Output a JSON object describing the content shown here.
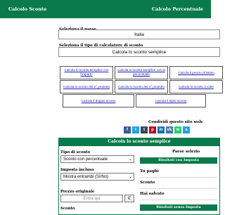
{
  "top_nav": {
    "tab1": "Calcolo Sconto",
    "tab2": "Calcolo Percentuale"
  },
  "country": {
    "label": "Seleziona il paese",
    "value": "Italia"
  },
  "calc_type": {
    "label": "Seleziona il tipo di calcolatore di sconto",
    "value": "Calcola lo sconto semplice"
  },
  "buttons": {
    "row1": [
      "Calcola lo sconto semplice con l'importo",
      "Calcola lo sconto semplice con la percentuale",
      "Calcola il prezzo di listino"
    ],
    "row2": [
      "Calcola lo sconto del 2° prodotto",
      "Calcola lo sconto del 3° prodotto",
      "Calcola lo sconto 2 volte"
    ],
    "row3": [
      "Calcola il doppio sconto",
      "Calcola il triplo sconto"
    ]
  },
  "share": {
    "title": "Condividi questo sito web:",
    "icons": [
      {
        "name": "facebook-icon",
        "glyph": "f",
        "color": "#3b5998"
      },
      {
        "name": "twitter-icon",
        "glyph": "t",
        "color": "#1da1f2"
      },
      {
        "name": "tumblr-icon",
        "glyph": "t",
        "color": "#35465c"
      },
      {
        "name": "pinterest-icon",
        "glyph": "p",
        "color": "#bd081c"
      },
      {
        "name": "linkedin-icon",
        "glyph": "in",
        "color": "#0077b5"
      },
      {
        "name": "vk-icon",
        "glyph": "vk",
        "color": "#4a76a8"
      },
      {
        "name": "whatsapp-icon",
        "glyph": "w",
        "color": "#25d366"
      },
      {
        "name": "share-icon",
        "glyph": "s",
        "color": "#1da1f2"
      }
    ]
  },
  "calculator": {
    "header": "Calcola lo sconto semplice",
    "discount_type": {
      "label": "Tipo di sconto",
      "value": "Sconto con percentuale"
    },
    "tax": {
      "label": "Imposta inclusa",
      "value": "Mostra entrambi (Sì/No)"
    },
    "price": {
      "label": "Prezzo originale",
      "placeholder": "Entra qui",
      "currency": "€"
    },
    "discount_label": "Sconto",
    "result": {
      "title": "Paese selezio",
      "tax_header": "Risultati con Imposta",
      "rows": [
        "Tu paghi",
        "Sconto",
        "Hai salvato"
      ],
      "notax_header": "Risultati senza Imposta"
    }
  },
  "colors": {
    "brand": "#0a7a4a",
    "link": "#1a1ab0"
  }
}
